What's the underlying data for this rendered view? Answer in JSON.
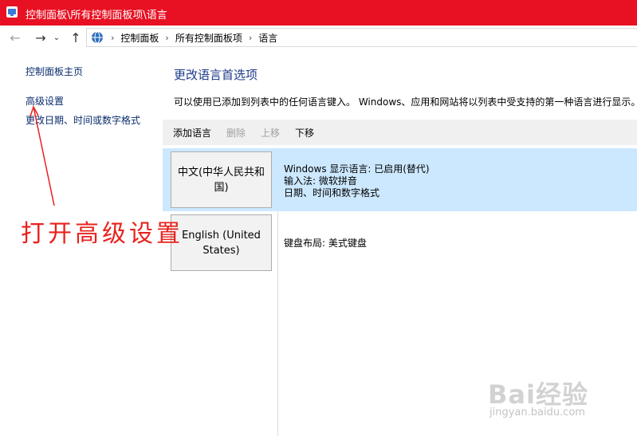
{
  "window": {
    "title": "控制面板\\所有控制面板项\\语言"
  },
  "address": {
    "crumbs": [
      "控制面板",
      "所有控制面板项",
      "语言"
    ]
  },
  "sidebar": {
    "items": [
      {
        "label": "控制面板主页"
      },
      {
        "label": "高级设置"
      },
      {
        "label": "更改日期、时间或数字格式"
      }
    ]
  },
  "main": {
    "heading": "更改语言首选项",
    "description": "可以使用已添加到列表中的任何语言键入。 Windows、应用和网站将以列表中受支持的第一种语言进行显示。"
  },
  "toolbar": {
    "add": "添加语言",
    "remove": "删除",
    "up": "上移",
    "down": "下移"
  },
  "languages": [
    {
      "name": "中文(中华人民共和国)",
      "details": [
        "Windows 显示语言: 已启用(替代)",
        "输入法: 微软拼音",
        "日期、时间和数字格式"
      ]
    },
    {
      "name": "English (United States)",
      "details": [
        "键盘布局: 美式键盘"
      ]
    }
  ],
  "annotation": {
    "text": "打开高级设置",
    "color": "#e8221e"
  },
  "watermark": {
    "main": "Bai经验",
    "sub": "jingyan.baidu.com"
  },
  "colors": {
    "titlebar": "#e81123",
    "selected_row": "#cce8ff",
    "link": "#0a2d6e",
    "heading": "#1e3a8a"
  }
}
